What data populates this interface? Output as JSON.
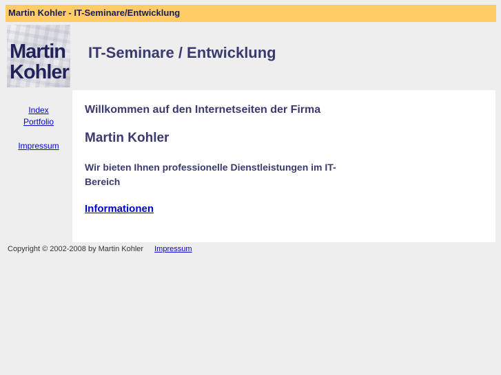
{
  "title_bar": {
    "text": "Martin Kohler - IT-Seminare/Entwicklung"
  },
  "logo": {
    "line1": "Martin",
    "line2": "Kohler"
  },
  "header": {
    "title": "IT-Seminare / Entwicklung"
  },
  "sidebar": {
    "items": [
      {
        "label": "Index"
      },
      {
        "label": "Portfolio"
      },
      {
        "label": "Impressum"
      }
    ]
  },
  "content": {
    "welcome": "Willkommen auf den Internetseiten der Firma",
    "company": "Martin Kohler",
    "offer": "Wir bieten Ihnen professionelle Dienstleistungen im IT-Bereich",
    "info_link": "Informationen"
  },
  "footer": {
    "copyright": "Copyright © 2002-2008 by Martin Kohler",
    "impressum_link": "Impressum"
  },
  "colors": {
    "title_bar_bg": "#ffcc66",
    "heading_text": "#3a3a6e",
    "link": "#0000cc",
    "page_bg": "#eeeeee",
    "content_bg": "#ffffff"
  }
}
